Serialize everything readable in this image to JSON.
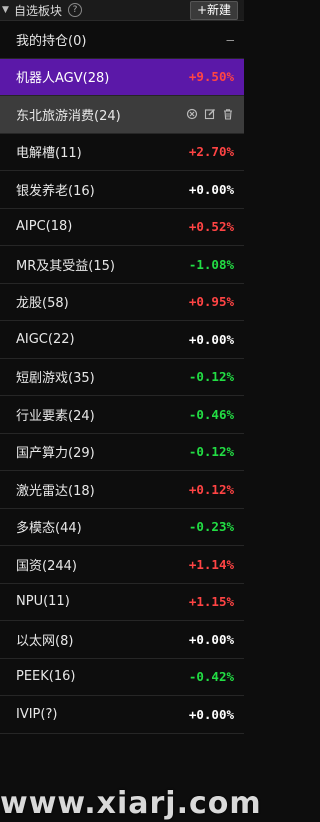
{
  "header": {
    "title": "自选板块",
    "help_icon": "?",
    "new_label": "+新建"
  },
  "watermark": "www.xiarj.com",
  "rows": [
    {
      "name": "我的持仓(0)",
      "pct": "—",
      "dir": "none"
    },
    {
      "name": "机器人AGV(28)",
      "pct": "+9.50%",
      "dir": "up"
    },
    {
      "name": "东北旅游消费(24)",
      "pct": "",
      "dir": "none"
    },
    {
      "name": "电解槽(11)",
      "pct": "+2.70%",
      "dir": "up"
    },
    {
      "name": "银发养老(16)",
      "pct": "+0.00%",
      "dir": "flat"
    },
    {
      "name": "AIPC(18)",
      "pct": "+0.52%",
      "dir": "up"
    },
    {
      "name": "MR及其受益(15)",
      "pct": "-1.08%",
      "dir": "down"
    },
    {
      "name": "龙股(58)",
      "pct": "+0.95%",
      "dir": "up"
    },
    {
      "name": "AIGC(22)",
      "pct": "+0.00%",
      "dir": "flat"
    },
    {
      "name": "短剧游戏(35)",
      "pct": "-0.12%",
      "dir": "down"
    },
    {
      "name": "行业要素(24)",
      "pct": "-0.46%",
      "dir": "down"
    },
    {
      "name": "国产算力(29)",
      "pct": "-0.12%",
      "dir": "down"
    },
    {
      "name": "激光雷达(18)",
      "pct": "+0.12%",
      "dir": "up"
    },
    {
      "name": "多模态(44)",
      "pct": "-0.23%",
      "dir": "down"
    },
    {
      "name": "国资(244)",
      "pct": "+1.14%",
      "dir": "up"
    },
    {
      "name": "NPU(11)",
      "pct": "+1.15%",
      "dir": "up"
    },
    {
      "name": "以太网(8)",
      "pct": "+0.00%",
      "dir": "flat"
    },
    {
      "name": "PEEK(16)",
      "pct": "-0.42%",
      "dir": "down"
    },
    {
      "name": "IVIP(?)",
      "pct": "+0.00%",
      "dir": "flat"
    }
  ],
  "colors": {
    "up": "#ff4444",
    "down": "#22dd44",
    "flat": "#ffffff",
    "selected": "#5b18a8",
    "hover": "#3c3c3c"
  },
  "icons": {
    "row_actions": [
      "settings-icon",
      "edit-icon",
      "delete-icon"
    ]
  }
}
